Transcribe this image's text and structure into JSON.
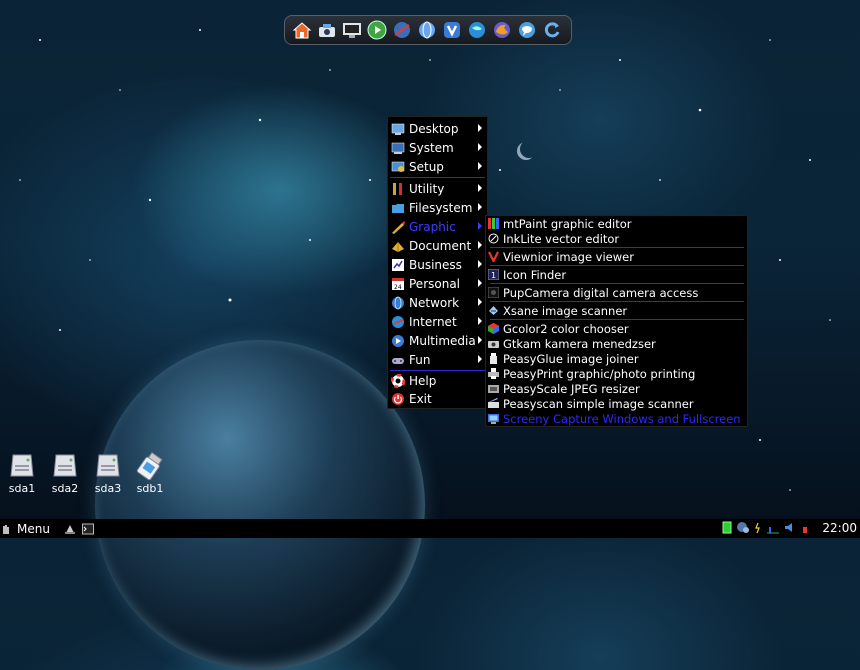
{
  "dock": {
    "icons": [
      "home-icon",
      "camera-icon",
      "monitor-icon",
      "play-icon",
      "globe-icon",
      "web-icon",
      "vivaldi-icon",
      "browser-icon",
      "firefox-icon",
      "chat-icon",
      "refresh-icon"
    ]
  },
  "main_menu": {
    "items": [
      {
        "label": "Desktop",
        "icon": "desktop-icon",
        "has_submenu": true
      },
      {
        "label": "System",
        "icon": "system-icon",
        "has_submenu": true
      },
      {
        "label": "Setup",
        "icon": "setup-icon",
        "has_submenu": true
      },
      {
        "label": "Utility",
        "icon": "utility-icon",
        "has_submenu": true
      },
      {
        "label": "Filesystem",
        "icon": "filesystem-icon",
        "has_submenu": true
      },
      {
        "label": "Graphic",
        "icon": "graphic-icon",
        "has_submenu": true,
        "active": true
      },
      {
        "label": "Document",
        "icon": "document-icon",
        "has_submenu": true
      },
      {
        "label": "Business",
        "icon": "business-icon",
        "has_submenu": true
      },
      {
        "label": "Personal",
        "icon": "personal-icon",
        "has_submenu": true
      },
      {
        "label": "Network",
        "icon": "network-icon",
        "has_submenu": true
      },
      {
        "label": "Internet",
        "icon": "internet-icon",
        "has_submenu": true
      },
      {
        "label": "Multimedia",
        "icon": "multimedia-icon",
        "has_submenu": true
      },
      {
        "label": "Fun",
        "icon": "fun-icon",
        "has_submenu": true
      },
      {
        "label": "Help",
        "icon": "help-icon",
        "has_submenu": false
      },
      {
        "label": "Exit",
        "icon": "exit-icon",
        "has_submenu": false
      }
    ]
  },
  "graphic_submenu": {
    "items": [
      {
        "label": "mtPaint graphic editor",
        "icon": "mtpaint-icon"
      },
      {
        "label": "InkLite vector editor",
        "icon": "inklite-icon"
      },
      {
        "label": "Viewnior image viewer",
        "icon": "viewnior-icon"
      },
      {
        "label": "Icon Finder",
        "icon": "iconfinder-icon"
      },
      {
        "label": "PupCamera digital camera access",
        "icon": "pupcamera-icon"
      },
      {
        "label": "Xsane image scanner",
        "icon": "xsane-icon"
      },
      {
        "label": "Gcolor2 color chooser",
        "icon": "gcolor2-icon"
      },
      {
        "label": "Gtkam kamera menedzser",
        "icon": "gtkam-icon"
      },
      {
        "label": "PeasyGlue image joiner",
        "icon": "peasyglue-icon"
      },
      {
        "label": "PeasyPrint graphic/photo printing",
        "icon": "peasyprint-icon"
      },
      {
        "label": "PeasyScale JPEG resizer",
        "icon": "peasyscale-icon"
      },
      {
        "label": "Peasyscan simple image scanner",
        "icon": "peasyscan-icon"
      },
      {
        "label": "Screeny Capture Windows and Fullscreen",
        "icon": "screeny-icon",
        "active": true
      }
    ]
  },
  "desktop_drives": [
    {
      "label": "sda1",
      "icon": "hard-drive-icon"
    },
    {
      "label": "sda2",
      "icon": "hard-drive-icon"
    },
    {
      "label": "sda3",
      "icon": "hard-drive-icon"
    },
    {
      "label": "sdb1",
      "icon": "usb-drive-icon"
    }
  ],
  "taskbar": {
    "menu_label": "Menu",
    "clock": "22:00",
    "tray_icons": [
      "battery-icon",
      "network-icon",
      "power-icon",
      "cpu-icon",
      "volume-icon",
      "update-icon"
    ]
  },
  "colors": {
    "menu_bg": "#000000",
    "highlight": "#3c3cff",
    "separator": "#2a2ad0"
  }
}
